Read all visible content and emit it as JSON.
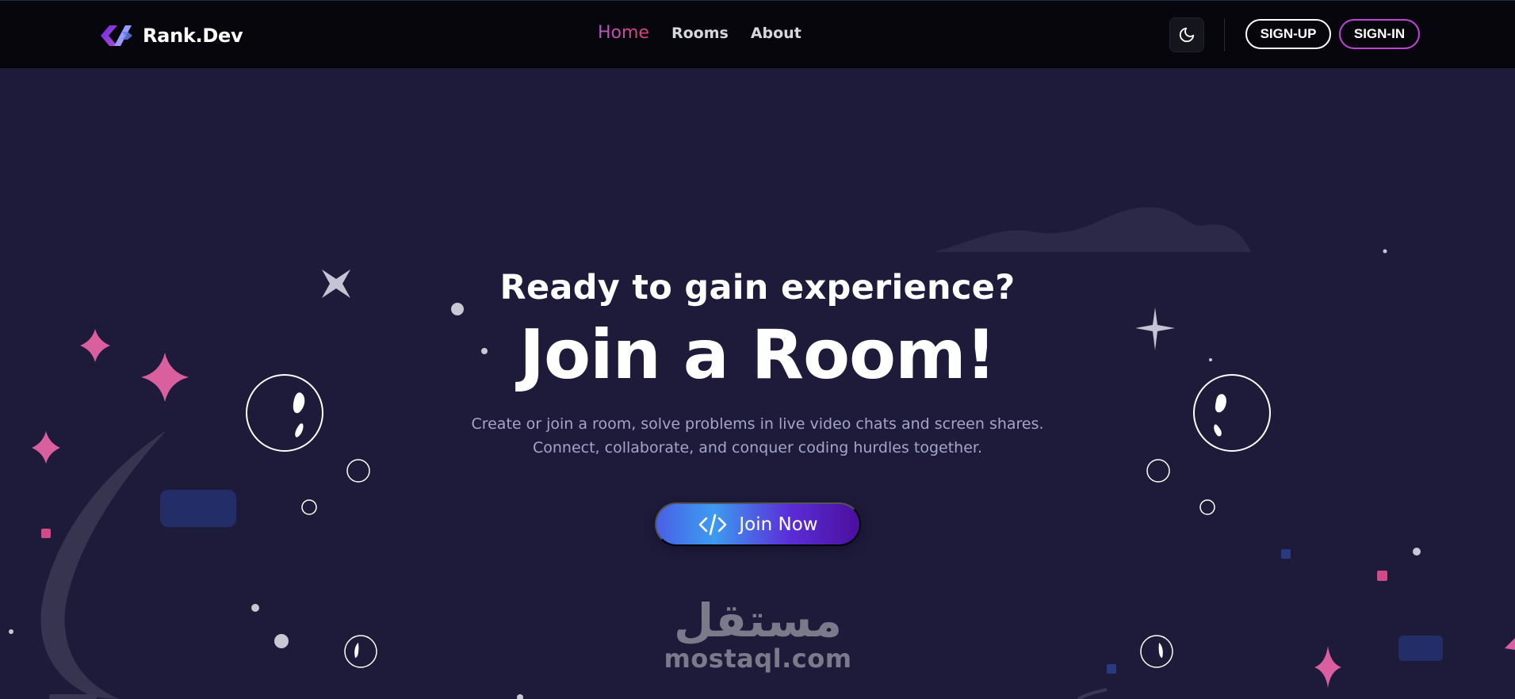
{
  "header": {
    "brand_name": "Rank.Dev",
    "nav": [
      {
        "label": "Home",
        "active": true
      },
      {
        "label": "Rooms",
        "active": false
      },
      {
        "label": "About",
        "active": false
      }
    ],
    "theme_toggle_icon": "moon-icon",
    "signup_label": "SIGN-UP",
    "signin_label": "SIGN-IN"
  },
  "hero": {
    "kicker": "Ready to gain experience?",
    "title": "Join a Room!",
    "description_lines": [
      "Create or join a room, solve problems in live video chats and screen shares.",
      "Connect, collaborate, and conquer coding hurdles together."
    ],
    "cta_label": "Join Now",
    "cta_icon": "code-icon"
  },
  "watermark": {
    "arabic": "مستقل",
    "latin": "mostaql.com"
  },
  "colors": {
    "navbar_bg": "#07060d",
    "page_bg": "#1e1b3a",
    "active_nav": "#c0467a",
    "signin_border": "#c045d6",
    "sparkle_pink": "#d95f9f",
    "description_text": "#a4a5c8"
  }
}
